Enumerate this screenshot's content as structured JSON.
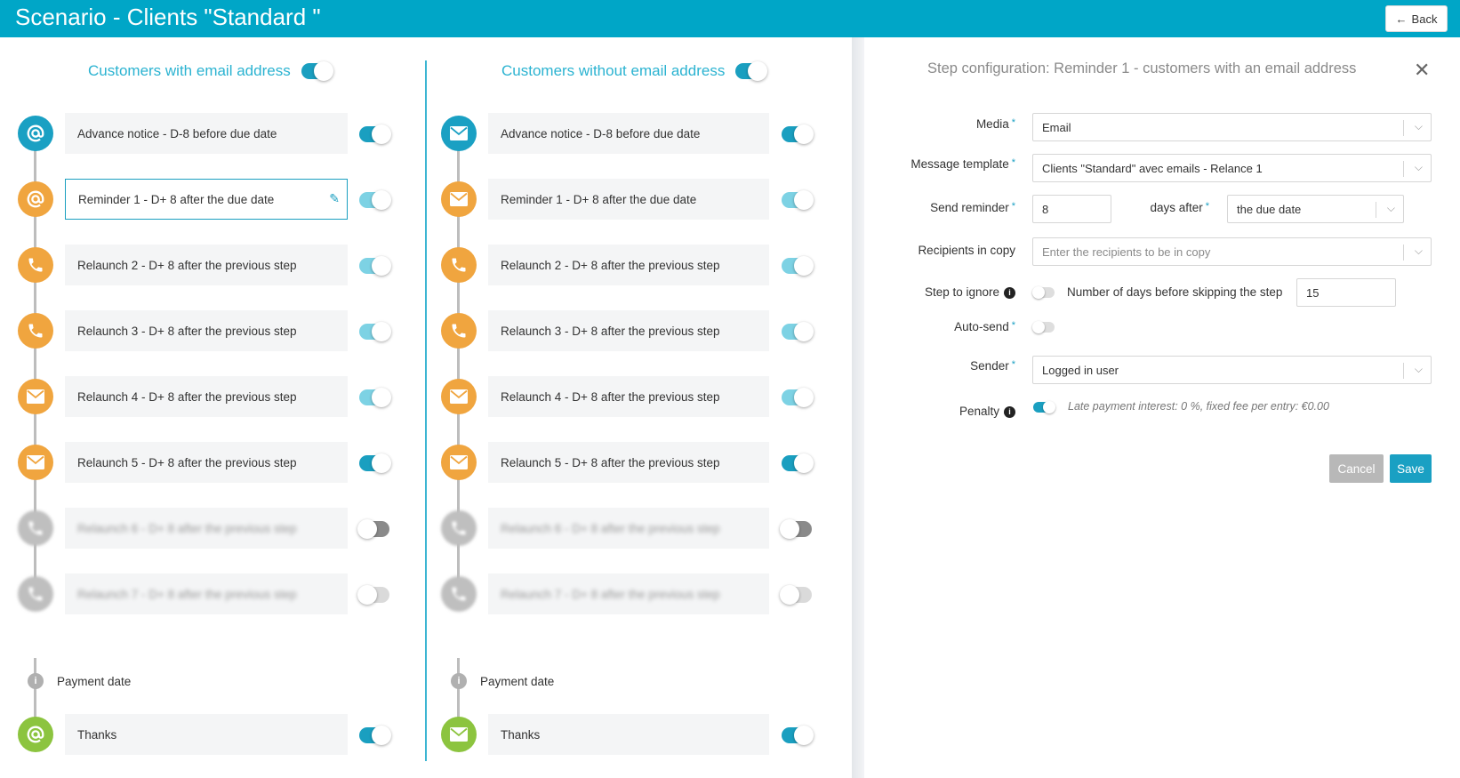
{
  "header": {
    "title": "Scenario - Clients \"Standard \"",
    "back_label": "Back"
  },
  "columns": [
    {
      "title": "Customers with email address",
      "toggle": "on"
    },
    {
      "title": "Customers without email address",
      "toggle": "on"
    }
  ],
  "steps_left": [
    {
      "label": "Advance notice - D-8 before due date",
      "icon": "at-icon",
      "color": "blue",
      "toggle": "on"
    },
    {
      "label": "Reminder 1 - D+ 8 after the due date",
      "icon": "at-icon",
      "color": "orange",
      "toggle": "light",
      "selected": true
    },
    {
      "label": "Relaunch 2 - D+ 8 after the previous step",
      "icon": "phone-icon",
      "color": "orange",
      "toggle": "light"
    },
    {
      "label": "Relaunch 3 - D+ 8 after the previous step",
      "icon": "phone-icon",
      "color": "orange",
      "toggle": "light"
    },
    {
      "label": "Relaunch 4 - D+ 8 after the previous step",
      "icon": "envelope-icon",
      "color": "orange",
      "toggle": "light"
    },
    {
      "label": "Relaunch 5 - D+ 8 after the previous step",
      "icon": "envelope-icon",
      "color": "orange",
      "toggle": "on"
    },
    {
      "label": "Relaunch 6 - D+ 8 after the previous step",
      "icon": "phone-icon",
      "color": "grey",
      "toggle": "off",
      "disabled": true
    },
    {
      "label": "Relaunch 7 - D+ 8 after the previous step",
      "icon": "phone-icon",
      "color": "grey",
      "toggle": "offlight",
      "disabled": true
    }
  ],
  "steps_right": [
    {
      "label": "Advance notice - D-8 before due date",
      "icon": "envelope-icon",
      "color": "blue",
      "toggle": "on"
    },
    {
      "label": "Reminder 1 - D+ 8 after the due date",
      "icon": "envelope-icon",
      "color": "orange",
      "toggle": "light"
    },
    {
      "label": "Relaunch 2 - D+ 8 after the previous step",
      "icon": "phone-icon",
      "color": "orange",
      "toggle": "light"
    },
    {
      "label": "Relaunch 3 - D+ 8 after the previous step",
      "icon": "phone-icon",
      "color": "orange",
      "toggle": "light"
    },
    {
      "label": "Relaunch 4 - D+ 8 after the previous step",
      "icon": "envelope-icon",
      "color": "orange",
      "toggle": "light"
    },
    {
      "label": "Relaunch 5 - D+ 8 after the previous step",
      "icon": "envelope-icon",
      "color": "orange",
      "toggle": "on"
    },
    {
      "label": "Relaunch 6 - D+ 8 after the previous step",
      "icon": "phone-icon",
      "color": "grey",
      "toggle": "off",
      "disabled": true
    },
    {
      "label": "Relaunch 7 - D+ 8 after the previous step",
      "icon": "phone-icon",
      "color": "grey",
      "toggle": "offlight",
      "disabled": true
    }
  ],
  "payment_date_label": "Payment date",
  "thanks": {
    "left_label": "Thanks",
    "right_label": "Thanks"
  },
  "config": {
    "title": "Step configuration: Reminder 1 - customers with an email address",
    "media_label": "Media",
    "media_value": "Email",
    "template_label": "Message template",
    "template_value": "Clients \"Standard\" avec emails - Relance 1",
    "send_label": "Send reminder",
    "send_value": "8",
    "days_after_label": "days after",
    "days_after_value": "the due date",
    "recipients_label": "Recipients in copy",
    "recipients_placeholder": "Enter the recipients to be in copy",
    "ignore_label": "Step to ignore",
    "skip_label": "Number of days before skipping the step",
    "skip_value": "15",
    "autosend_label": "Auto-send",
    "sender_label": "Sender",
    "sender_value": "Logged in user",
    "penalty_label": "Penalty",
    "penalty_note": "Late payment interest: 0 %, fixed fee per entry: €0.00",
    "cancel_label": "Cancel",
    "save_label": "Save",
    "required_mark": "*",
    "info_glyph": "i"
  },
  "colors": {
    "brand": "#00a6c7",
    "accent": "#1aa0c3",
    "orange": "#f0a53f",
    "green": "#8cc43f"
  }
}
